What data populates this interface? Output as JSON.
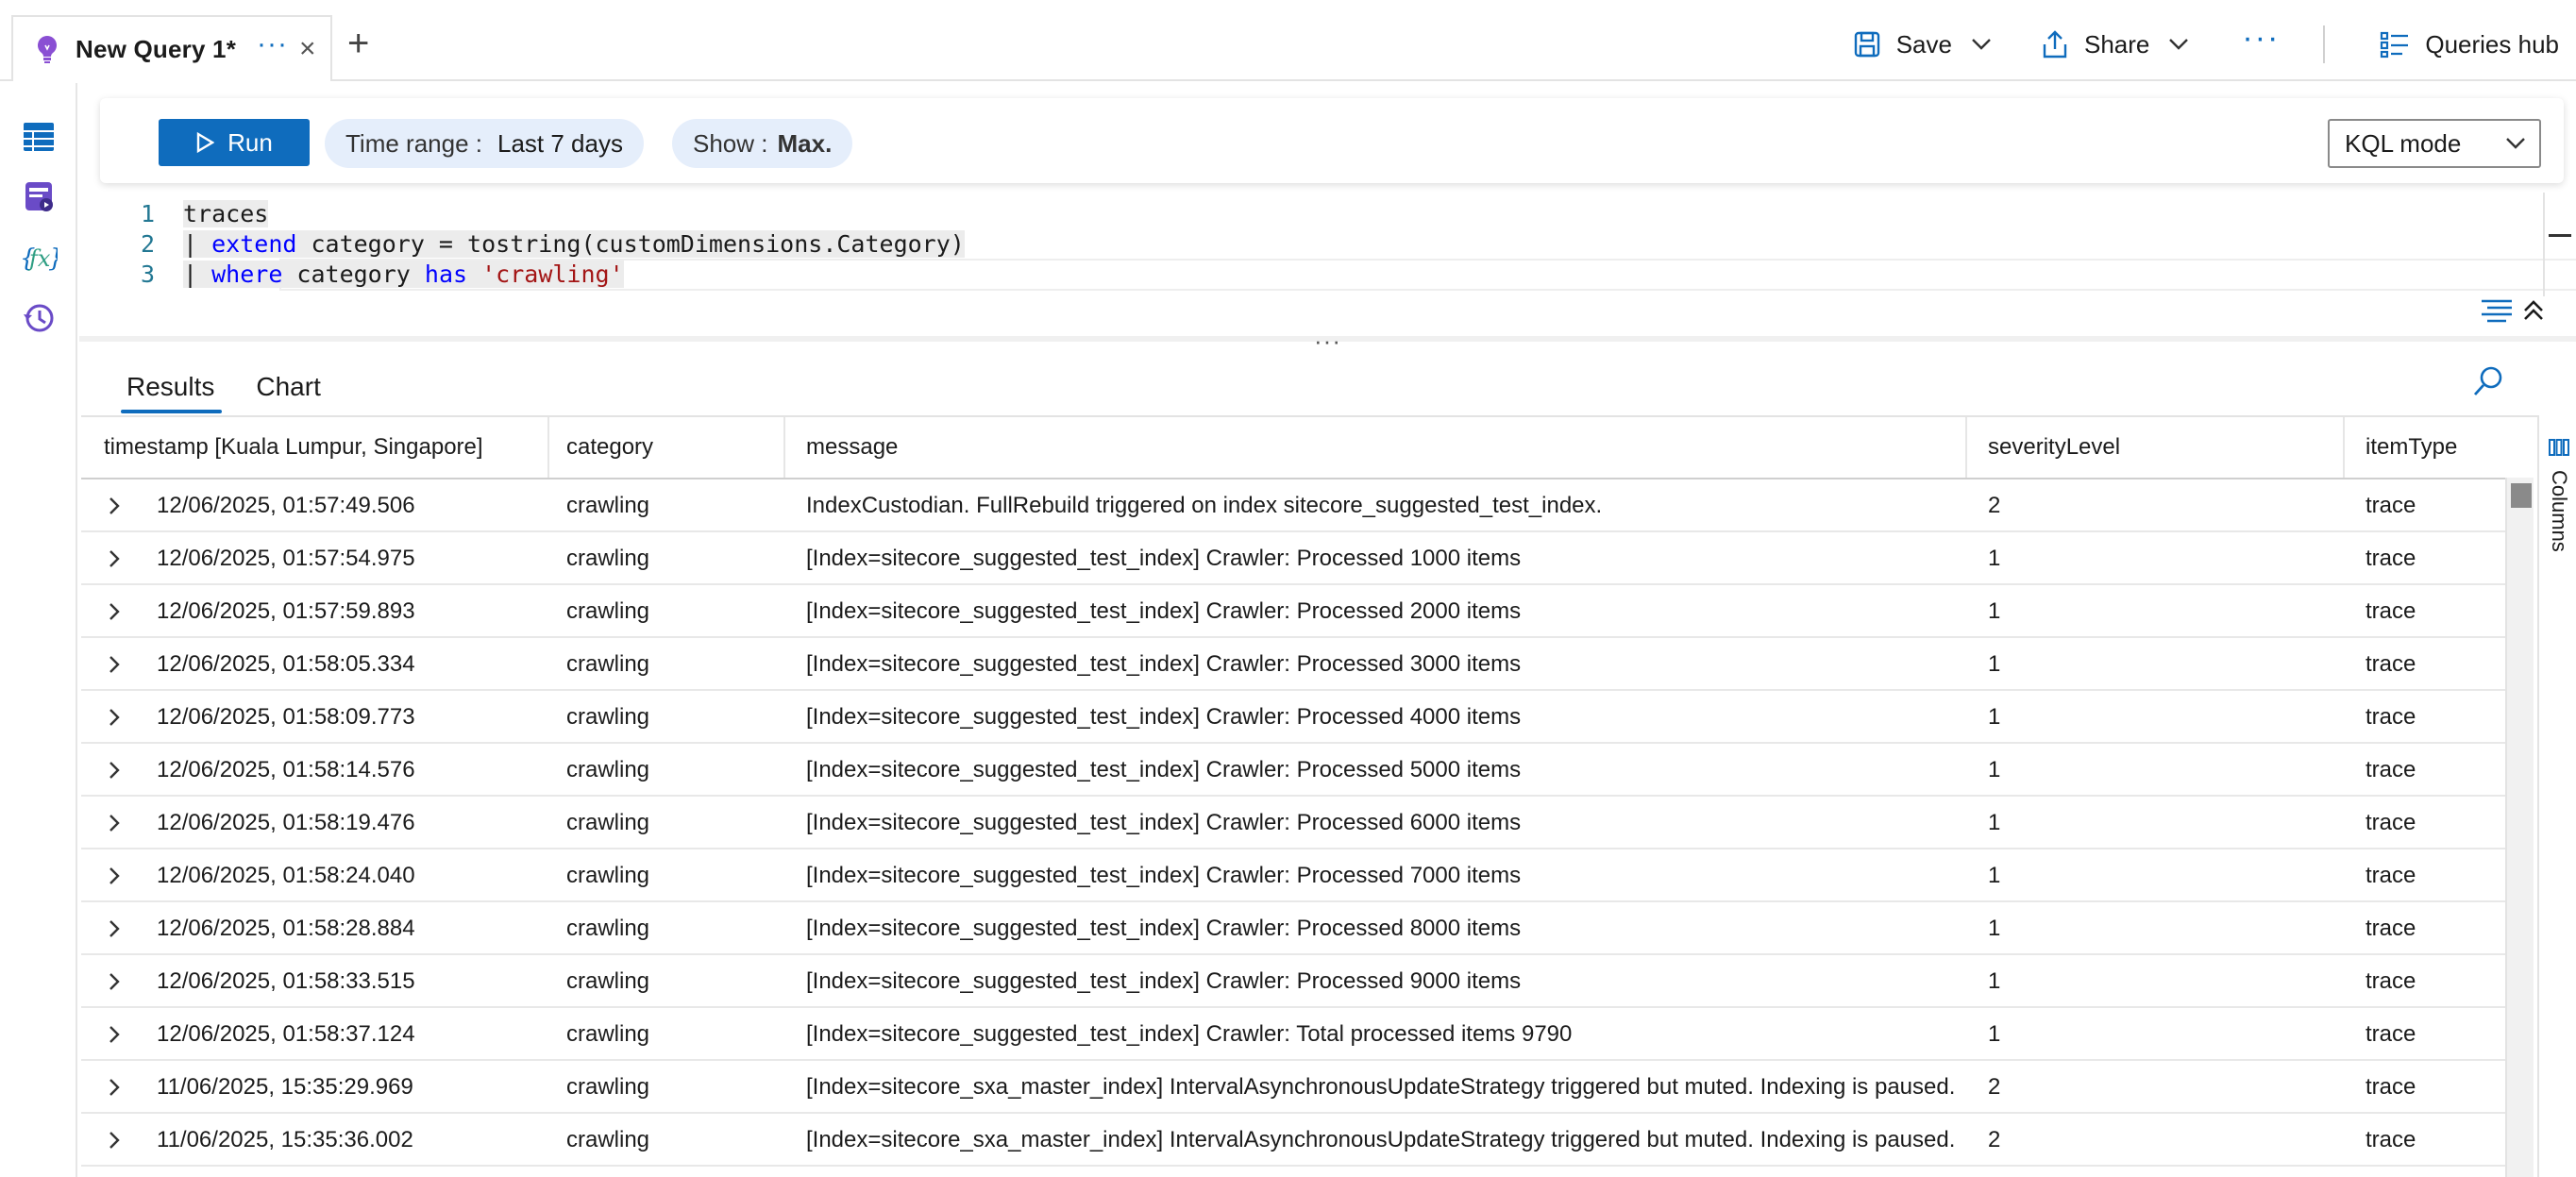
{
  "tab": {
    "title": "New Query 1*",
    "more": "···",
    "close": "×",
    "add": "+"
  },
  "top_actions": {
    "save": "Save",
    "share": "Share",
    "more": "···",
    "queries_hub": "Queries hub"
  },
  "toolbar": {
    "run": "Run",
    "time_range_label": "Time range :",
    "time_range_value": "Last 7 days",
    "show_label": "Show :",
    "show_value": "Max.",
    "mode": "KQL mode"
  },
  "editor": {
    "lines": [
      {
        "num": "1",
        "text": "traces"
      },
      {
        "num": "2",
        "pipe": "| ",
        "kw": "extend",
        "rest": " category = tostring(customDimensions.Category)"
      },
      {
        "num": "3",
        "pipe": "| ",
        "kw": "where",
        "mid": " category ",
        "kw2": "has",
        "sp": " ",
        "str": "'crawling'"
      }
    ]
  },
  "results_tabs": [
    "Results",
    "Chart"
  ],
  "columns_panel": "Columns",
  "grid": {
    "headers": [
      "timestamp [Kuala Lumpur, Singapore]",
      "category",
      "message",
      "severityLevel",
      "itemType"
    ],
    "rows": [
      [
        "12/06/2025, 01:57:49.506",
        "crawling",
        "IndexCustodian. FullRebuild triggered on index sitecore_suggested_test_index.",
        "2",
        "trace"
      ],
      [
        "12/06/2025, 01:57:54.975",
        "crawling",
        "[Index=sitecore_suggested_test_index] Crawler: Processed 1000 items",
        "1",
        "trace"
      ],
      [
        "12/06/2025, 01:57:59.893",
        "crawling",
        "[Index=sitecore_suggested_test_index] Crawler: Processed 2000 items",
        "1",
        "trace"
      ],
      [
        "12/06/2025, 01:58:05.334",
        "crawling",
        "[Index=sitecore_suggested_test_index] Crawler: Processed 3000 items",
        "1",
        "trace"
      ],
      [
        "12/06/2025, 01:58:09.773",
        "crawling",
        "[Index=sitecore_suggested_test_index] Crawler: Processed 4000 items",
        "1",
        "trace"
      ],
      [
        "12/06/2025, 01:58:14.576",
        "crawling",
        "[Index=sitecore_suggested_test_index] Crawler: Processed 5000 items",
        "1",
        "trace"
      ],
      [
        "12/06/2025, 01:58:19.476",
        "crawling",
        "[Index=sitecore_suggested_test_index] Crawler: Processed 6000 items",
        "1",
        "trace"
      ],
      [
        "12/06/2025, 01:58:24.040",
        "crawling",
        "[Index=sitecore_suggested_test_index] Crawler: Processed 7000 items",
        "1",
        "trace"
      ],
      [
        "12/06/2025, 01:58:28.884",
        "crawling",
        "[Index=sitecore_suggested_test_index] Crawler: Processed 8000 items",
        "1",
        "trace"
      ],
      [
        "12/06/2025, 01:58:33.515",
        "crawling",
        "[Index=sitecore_suggested_test_index] Crawler: Processed 9000 items",
        "1",
        "trace"
      ],
      [
        "12/06/2025, 01:58:37.124",
        "crawling",
        "[Index=sitecore_suggested_test_index] Crawler: Total processed items 9790",
        "1",
        "trace"
      ],
      [
        "11/06/2025, 15:35:29.969",
        "crawling",
        "[Index=sitecore_sxa_master_index] IntervalAsynchronousUpdateStrategy triggered but muted. Indexing is paused.",
        "2",
        "trace"
      ],
      [
        "11/06/2025, 15:35:36.002",
        "crawling",
        "[Index=sitecore_sxa_master_index] IntervalAsynchronousUpdateStrategy triggered but muted. Indexing is paused.",
        "2",
        "trace"
      ]
    ]
  },
  "colors": {
    "accent": "#0f6cbd",
    "pill_bg": "#e5eefb",
    "keyword": "#0000ff",
    "string": "#a31515",
    "line_number": "#237893"
  },
  "icons": [
    "lightbulb-icon",
    "save-icon",
    "share-icon",
    "queries-hub-icon",
    "tables-icon",
    "queries-icon",
    "functions-icon",
    "history-icon",
    "play-icon",
    "chevron-down-icon",
    "format-icon",
    "collapse-icon",
    "search-icon",
    "columns-icon",
    "expand-row-icon"
  ]
}
